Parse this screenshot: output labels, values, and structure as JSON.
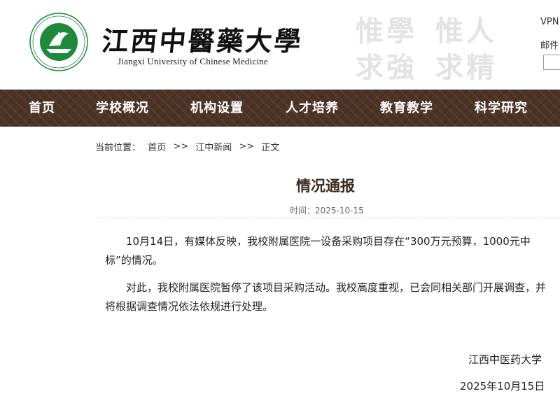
{
  "header": {
    "logo_cn": "江西中醫藥大學",
    "logo_en": "Jiangxi University of Chinese Medicine",
    "logo_ring_text": "江西中醫藥大學 Jiangxi University of Chinese Medicine",
    "motto": [
      "惟學",
      "惟人",
      "求強",
      "求精"
    ],
    "links": {
      "vpn": "VPN",
      "mail": "邮件"
    },
    "search_placeholder": ""
  },
  "nav": {
    "items": [
      {
        "label": "首页"
      },
      {
        "label": "学校概况"
      },
      {
        "label": "机构设置"
      },
      {
        "label": "人才培养"
      },
      {
        "label": "教育教学"
      },
      {
        "label": "科学研究"
      }
    ]
  },
  "breadcrumb": {
    "label": "当前位置：",
    "items": [
      "首页",
      "江中新闻",
      "正文"
    ],
    "separator": ">>"
  },
  "article": {
    "title": "情况通报",
    "time_label": "时间：",
    "date": "2025-10-15",
    "paragraphs": [
      "10月14日，有媒体反映，我校附属医院一设备采购项目存在“300万元预算，1000元中标”的情况。",
      "对此，我校附属医院暂停了该项目采购活动。我校高度重视，已会同相关部门开展调查，并将根据调查情况依法依规进行处理。"
    ],
    "signature_org": "江西中医药大学",
    "signature_date": "2025年10月15日"
  },
  "colors": {
    "nav_bg": "#4d3325",
    "logo_green": "#1c8a3a",
    "title_brown": "#3a2a20",
    "motto_gray": "#e3e3e3"
  },
  "icons": [
    "university-emblem-icon"
  ]
}
